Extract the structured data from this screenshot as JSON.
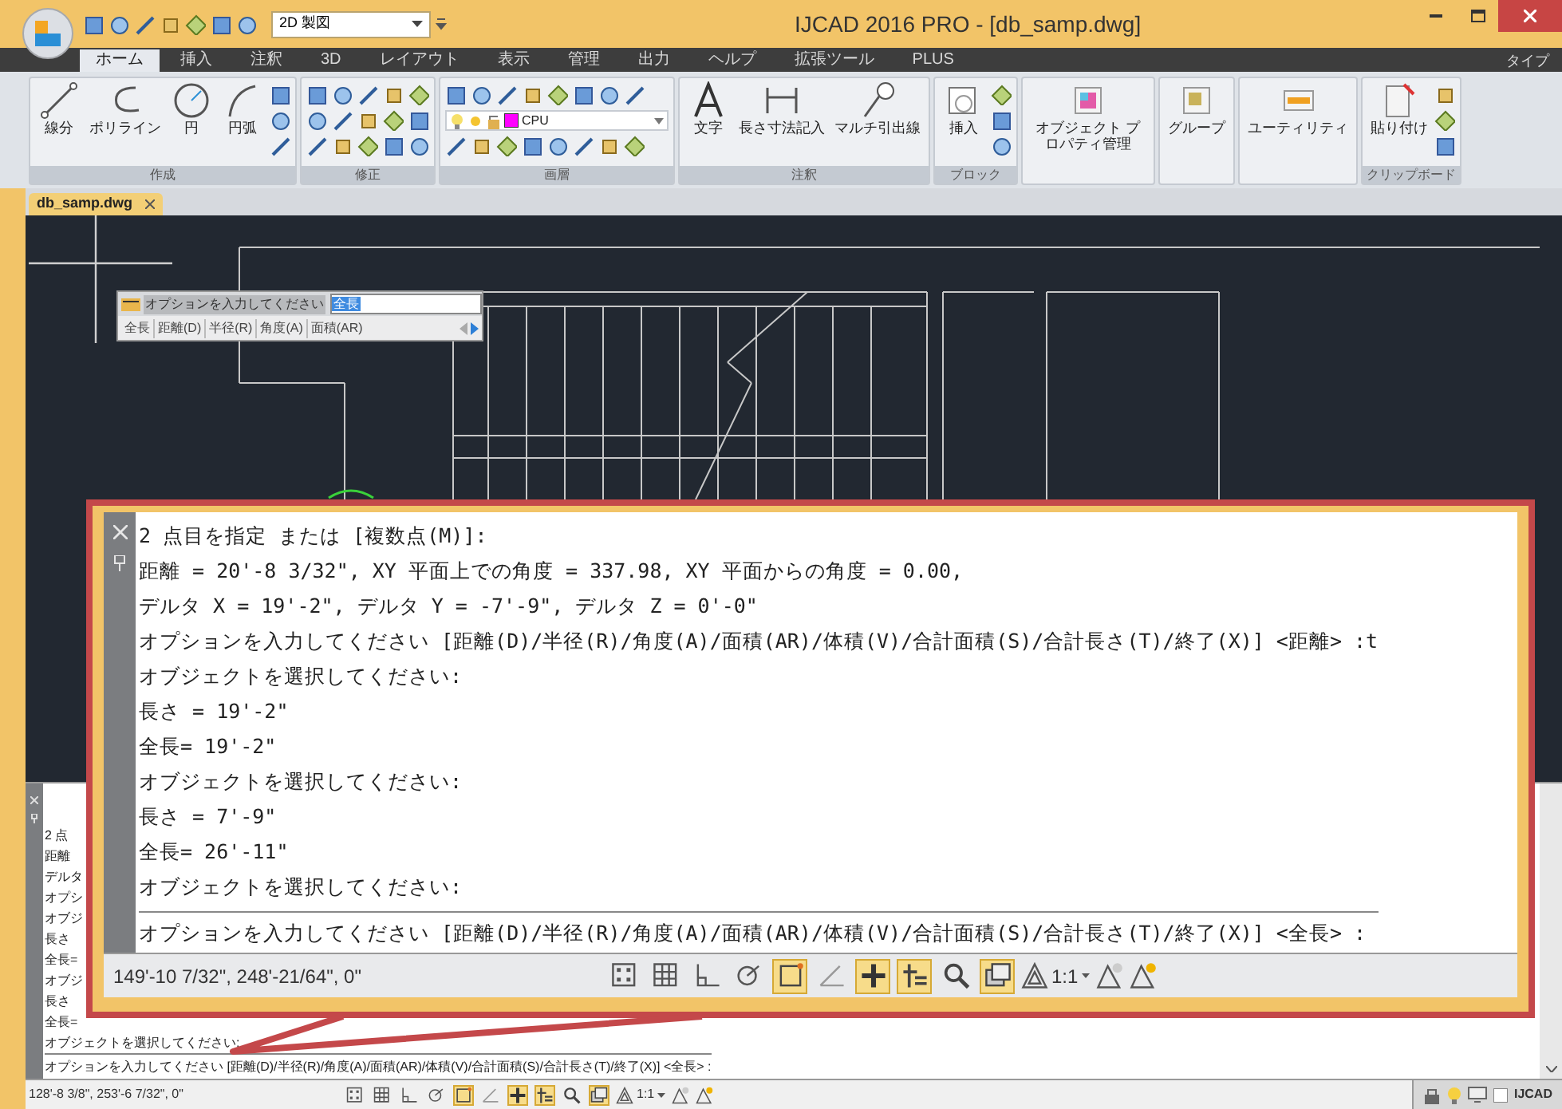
{
  "title_bar": {
    "title": "IJCAD 2016 PRO - [db_samp.dwg]",
    "workspace": "2D 製図"
  },
  "ribbon_tabs": [
    {
      "label": "ホーム",
      "selected": true
    },
    {
      "label": "挿入",
      "selected": false
    },
    {
      "label": "注釈",
      "selected": false
    },
    {
      "label": "3D",
      "selected": false
    },
    {
      "label": "レイアウト",
      "selected": false
    },
    {
      "label": "表示",
      "selected": false
    },
    {
      "label": "管理",
      "selected": false
    },
    {
      "label": "出力",
      "selected": false
    },
    {
      "label": "ヘルプ",
      "selected": false
    },
    {
      "label": "拡張ツール",
      "selected": false
    },
    {
      "label": "PLUS",
      "selected": false
    }
  ],
  "ribbon_type_menu": "タイプ",
  "ribbon_panels": [
    {
      "kind": "large",
      "title": "作成",
      "buttons": [
        "線分",
        "ポリライン",
        "円",
        "円弧"
      ]
    },
    {
      "kind": "icons",
      "title": "修正"
    },
    {
      "kind": "layer",
      "title": "画層",
      "layer": "CPU"
    },
    {
      "kind": "large",
      "title": "注釈",
      "buttons": [
        "文字",
        "長さ寸法記入",
        "マルチ引出線"
      ]
    },
    {
      "kind": "large",
      "title": "ブロック",
      "buttons": [
        "挿入"
      ]
    },
    {
      "kind": "large",
      "buttons": [
        "オブジェクト プロパティ管理"
      ]
    },
    {
      "kind": "large",
      "buttons": [
        "グループ"
      ]
    },
    {
      "kind": "large",
      "buttons": [
        "ユーティリティ"
      ]
    },
    {
      "kind": "large",
      "title": "クリップボード",
      "buttons": [
        "貼り付け"
      ]
    }
  ],
  "document_tab": "db_samp.dwg",
  "dynamic_input": {
    "prompt": "オプションを入力してください",
    "value": "全長",
    "options": [
      "全長",
      "距離(D)",
      "半径(R)",
      "角度(A)",
      "面積(AR)"
    ]
  },
  "command_window": {
    "history": [
      "2 点",
      "距離",
      "デルタ",
      "オプシ",
      "オブジ",
      "長さ",
      "全長=",
      "オブジ",
      "長さ",
      "全長=",
      "オブジェクトを選択してください:"
    ],
    "input": "オプションを入力してください [距離(D)/半径(R)/角度(A)/面積(AR)/体積(V)/合計面積(S)/合計長さ(T)/終了(X)] <全長> :"
  },
  "status_bar": {
    "coords": "128'-8 3/8\", 253'-6 7/32\", 0\"",
    "scale": "1:1",
    "tray_label": "IJCAD",
    "toggles": [
      {
        "on": false
      },
      {
        "on": false
      },
      {
        "on": false
      },
      {
        "on": false
      },
      {
        "on": true
      },
      {
        "on": false
      },
      {
        "on": true
      },
      {
        "on": true
      },
      {
        "on": false
      },
      {
        "on": true
      }
    ]
  },
  "callout": {
    "history": [
      "2 点目を指定 または [複数点(M)]:",
      "距離 = 20'-8 3/32\", XY 平面上での角度 = 337.98, XY 平面からの角度 = 0.00,",
      "デルタ X = 19'-2\", デルタ Y = -7'-9\", デルタ Z = 0'-0\"",
      "オプションを入力してください [距離(D)/半径(R)/角度(A)/面積(AR)/体積(V)/合計面積(S)/合計長さ(T)/終了(X)] <距離> :t",
      "オブジェクトを選択してください:",
      "長さ = 19'-2\"",
      "全長= 19'-2\"",
      "オブジェクトを選択してください:",
      "長さ = 7'-9\"",
      "全長= 26'-11\"",
      "オブジェクトを選択してください:"
    ],
    "input": "オプションを入力してください [距離(D)/半径(R)/角度(A)/面積(AR)/体積(V)/合計面積(S)/合計長さ(T)/終了(X)] <全長> :",
    "coords": "149'-10 7/32\", 248'-21/64\", 0\"",
    "scale": "1:1",
    "toggles": [
      {
        "on": false
      },
      {
        "on": false
      },
      {
        "on": false
      },
      {
        "on": false
      },
      {
        "on": true
      },
      {
        "on": false
      },
      {
        "on": true
      },
      {
        "on": true
      },
      {
        "on": false
      },
      {
        "on": true
      }
    ]
  }
}
